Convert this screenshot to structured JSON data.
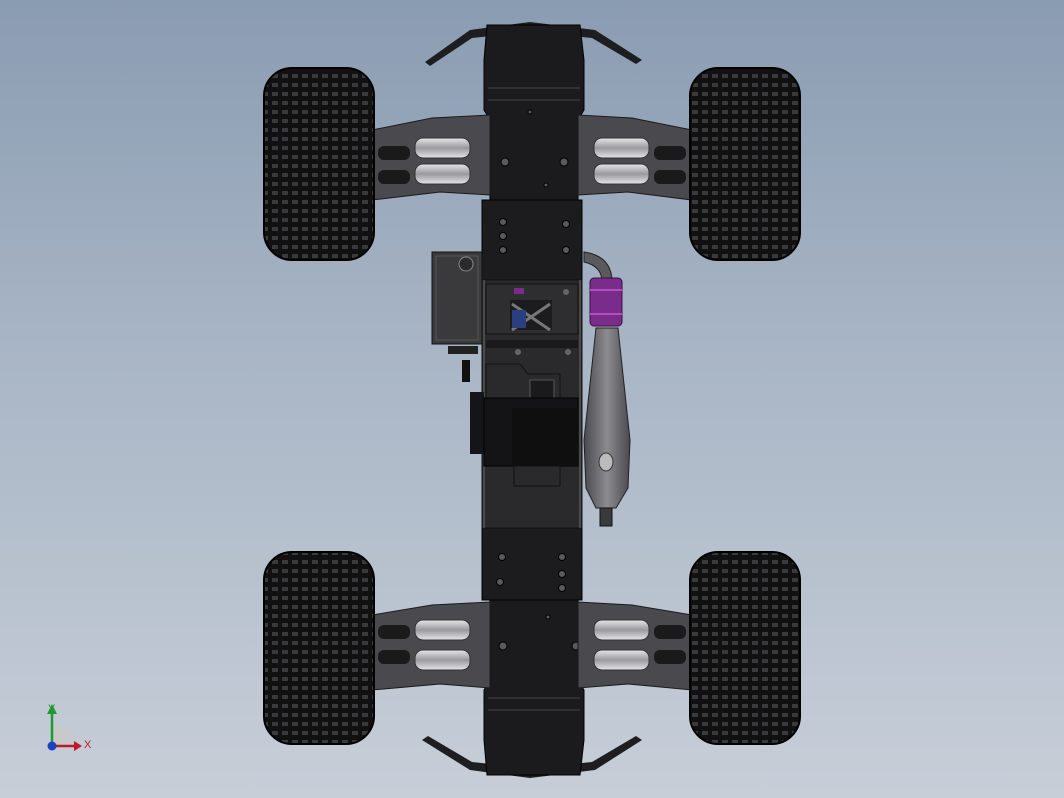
{
  "colors": {
    "background_top": "#8a9cb2",
    "background_bottom": "#c7ced8",
    "body": "#1e1e20",
    "arm": "#4a4a4e",
    "spring": "#b9b9bd",
    "exhaust": "#6e6e72",
    "muffler_accent": "#8a2a8c",
    "axis_x": "#c0182a",
    "axis_y": "#1f9a2e",
    "axis_z": "#1d3fc4"
  },
  "triad": {
    "x_label": "X",
    "y_label": "Y"
  }
}
